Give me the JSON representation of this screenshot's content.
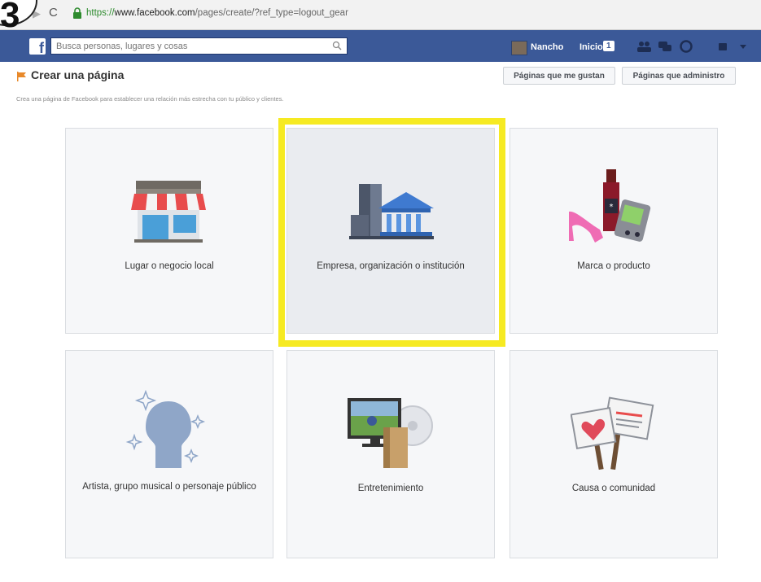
{
  "step": {
    "number": "3"
  },
  "browser": {
    "url_scheme": "https://",
    "url_host": "www.facebook.com",
    "url_path": "/pages/create/?ref_type=logout_gear"
  },
  "topbar": {
    "logo": "f",
    "search_placeholder": "Busca personas, lugares y cosas",
    "user_name": "Nancho",
    "home_label": "Inicio",
    "home_badge": "1",
    "color": "#3b5998"
  },
  "page": {
    "title": "Crear una página",
    "subtitle": "Crea una página de Facebook para establecer una relación más estrecha con tu público y clientes.",
    "buttons": [
      "Páginas que me gustan",
      "Páginas que administro"
    ]
  },
  "categories": [
    {
      "label": "Lugar o negocio local",
      "icon": "storefront-icon"
    },
    {
      "label": "Empresa, organización o institución",
      "icon": "company-building-icon"
    },
    {
      "label": "Marca o producto",
      "icon": "brand-products-icon"
    },
    {
      "label": "Artista, grupo musical o personaje público",
      "icon": "artist-silhouette-icon"
    },
    {
      "label": "Entretenimiento",
      "icon": "entertainment-media-icon"
    },
    {
      "label": "Causa o comunidad",
      "icon": "cause-signs-icon"
    }
  ],
  "highlight": {
    "selected_index": 1,
    "color": "#f6ea22"
  }
}
